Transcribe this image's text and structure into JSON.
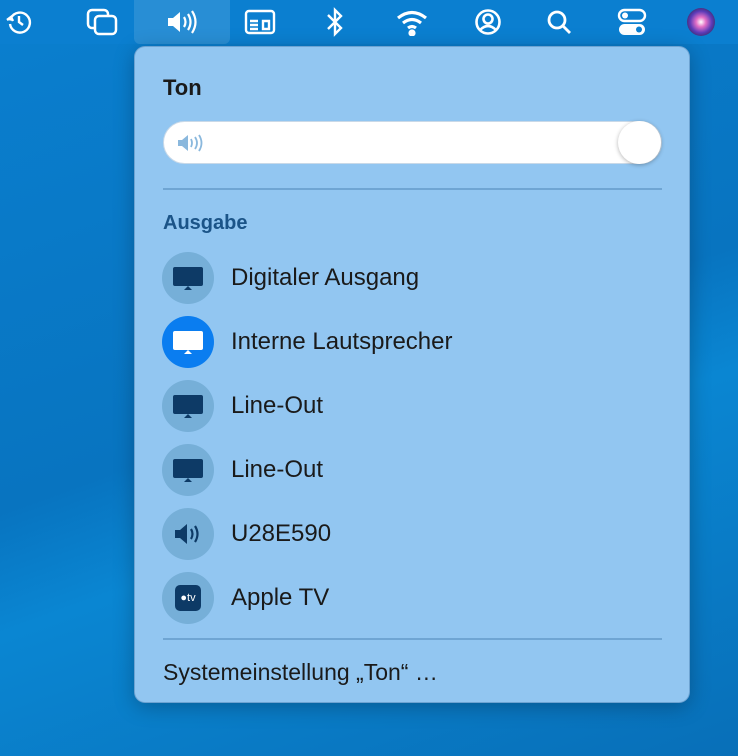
{
  "menubar": {
    "icons": [
      "time-machine-icon",
      "screen-mirroring-icon",
      "sound-icon",
      "keyboard-viewer-icon",
      "bluetooth-icon",
      "wifi-icon",
      "user-icon",
      "search-icon",
      "control-center-icon",
      "siri-icon"
    ]
  },
  "panel": {
    "title": "Ton",
    "volume": 0.97,
    "section": "Ausgabe",
    "devices": [
      {
        "label": "Digitaler Ausgang",
        "icon": "display-icon",
        "selected": false
      },
      {
        "label": "Interne Lautsprecher",
        "icon": "display-icon",
        "selected": true
      },
      {
        "label": "Line-Out",
        "icon": "display-icon",
        "selected": false
      },
      {
        "label": "Line-Out",
        "icon": "display-icon",
        "selected": false
      },
      {
        "label": "U28E590",
        "icon": "speaker-icon",
        "selected": false
      },
      {
        "label": "Apple TV",
        "icon": "apple-tv-icon",
        "selected": false
      }
    ],
    "tv_badge": "tv",
    "footer": "Systemeinstellung „Ton“ …"
  },
  "colors": {
    "accent": "#0a7df0",
    "panel": "#92c6f1"
  }
}
